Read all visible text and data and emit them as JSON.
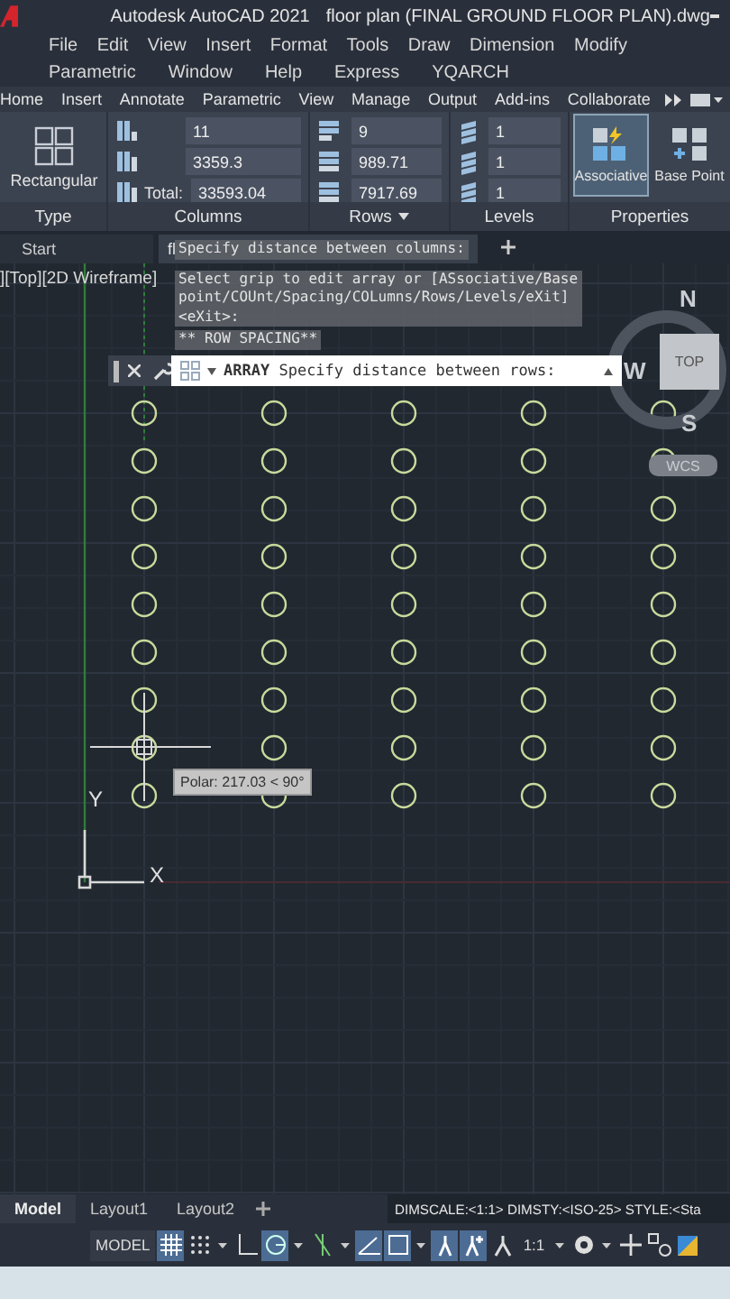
{
  "title_bar": {
    "app": "Autodesk AutoCAD 2021",
    "file": "floor plan (FINAL GROUND FLOOR PLAN).dwg"
  },
  "menu": [
    [
      "File",
      "Edit",
      "View",
      "Insert",
      "Format",
      "Tools",
      "Draw",
      "Dimension",
      "Modify"
    ],
    [
      "Parametric",
      "Window",
      "Help",
      "Express",
      "YQARCH"
    ]
  ],
  "ribbon_tabs": [
    "Home",
    "Insert",
    "Annotate",
    "Parametric",
    "View",
    "Manage",
    "Output",
    "Add-ins",
    "Collaborate"
  ],
  "ribbon": {
    "type": {
      "title": "Type",
      "button": "Rectangular"
    },
    "columns": {
      "title": "Columns",
      "fields": [
        {
          "value": "11"
        },
        {
          "value": "3359.3"
        },
        {
          "label": "Total:",
          "value": "33593.04"
        }
      ]
    },
    "rows": {
      "title": "Rows",
      "fields": [
        {
          "value": "9"
        },
        {
          "value": "989.71"
        },
        {
          "value": "7917.69"
        }
      ]
    },
    "levels": {
      "title": "Levels",
      "fields": [
        {
          "value": "1"
        },
        {
          "value": "1"
        },
        {
          "value": "1"
        }
      ]
    },
    "properties": {
      "title": "Properties",
      "buttons": [
        {
          "label": "Associative",
          "selected": true
        },
        {
          "label": "Base Point",
          "selected": false
        }
      ]
    }
  },
  "doc_tabs": [
    {
      "label": "Start",
      "selected": false
    },
    {
      "label": "fl",
      "selected": true
    }
  ],
  "command_history": [
    "Specify distance between columns:",
    "Select grip to edit array or [ASsociative/Base point/COUnt/Spacing/COLumns/Rows/Levels/eXit] <eXit>:",
    "** ROW SPACING**"
  ],
  "viewport": {
    "label": "][Top][2D Wireframe]",
    "tooltip": "Polar: 217.03 < 90°",
    "ucs": {
      "x": "X",
      "y": "Y"
    }
  },
  "command_line": {
    "command": "ARRAY",
    "prompt": "Specify distance between rows:"
  },
  "viewcube": {
    "north": "N",
    "west": "W",
    "south": "S",
    "face": "TOP",
    "wcs": "WCS"
  },
  "layout_tabs": [
    {
      "label": "Model",
      "selected": true
    },
    {
      "label": "Layout1",
      "selected": false
    },
    {
      "label": "Layout2",
      "selected": false
    }
  ],
  "status_text": "DIMSCALE:<1:1> DIMSTY:<ISO-25> STYLE:<Sta",
  "status_bar": [
    {
      "kind": "label",
      "text": "MODEL"
    },
    {
      "kind": "grid",
      "on": true
    },
    {
      "kind": "snap",
      "on": false
    },
    {
      "kind": "dropdown"
    },
    {
      "kind": "ortho",
      "on": false
    },
    {
      "kind": "polar",
      "on": true
    },
    {
      "kind": "dropdown"
    },
    {
      "kind": "isodraft",
      "on": false
    },
    {
      "kind": "dropdown"
    },
    {
      "kind": "angle",
      "on": true
    },
    {
      "kind": "selection",
      "on": true
    },
    {
      "kind": "dropdown"
    },
    {
      "kind": "annotation",
      "on": true
    },
    {
      "kind": "autoscale",
      "on": true
    },
    {
      "kind": "figure",
      "on": false
    },
    {
      "kind": "scale",
      "text": "1:1"
    },
    {
      "kind": "dropdown"
    },
    {
      "kind": "gear"
    },
    {
      "kind": "dropdown"
    },
    {
      "kind": "plus"
    },
    {
      "kind": "isolate"
    },
    {
      "kind": "hardware"
    }
  ]
}
